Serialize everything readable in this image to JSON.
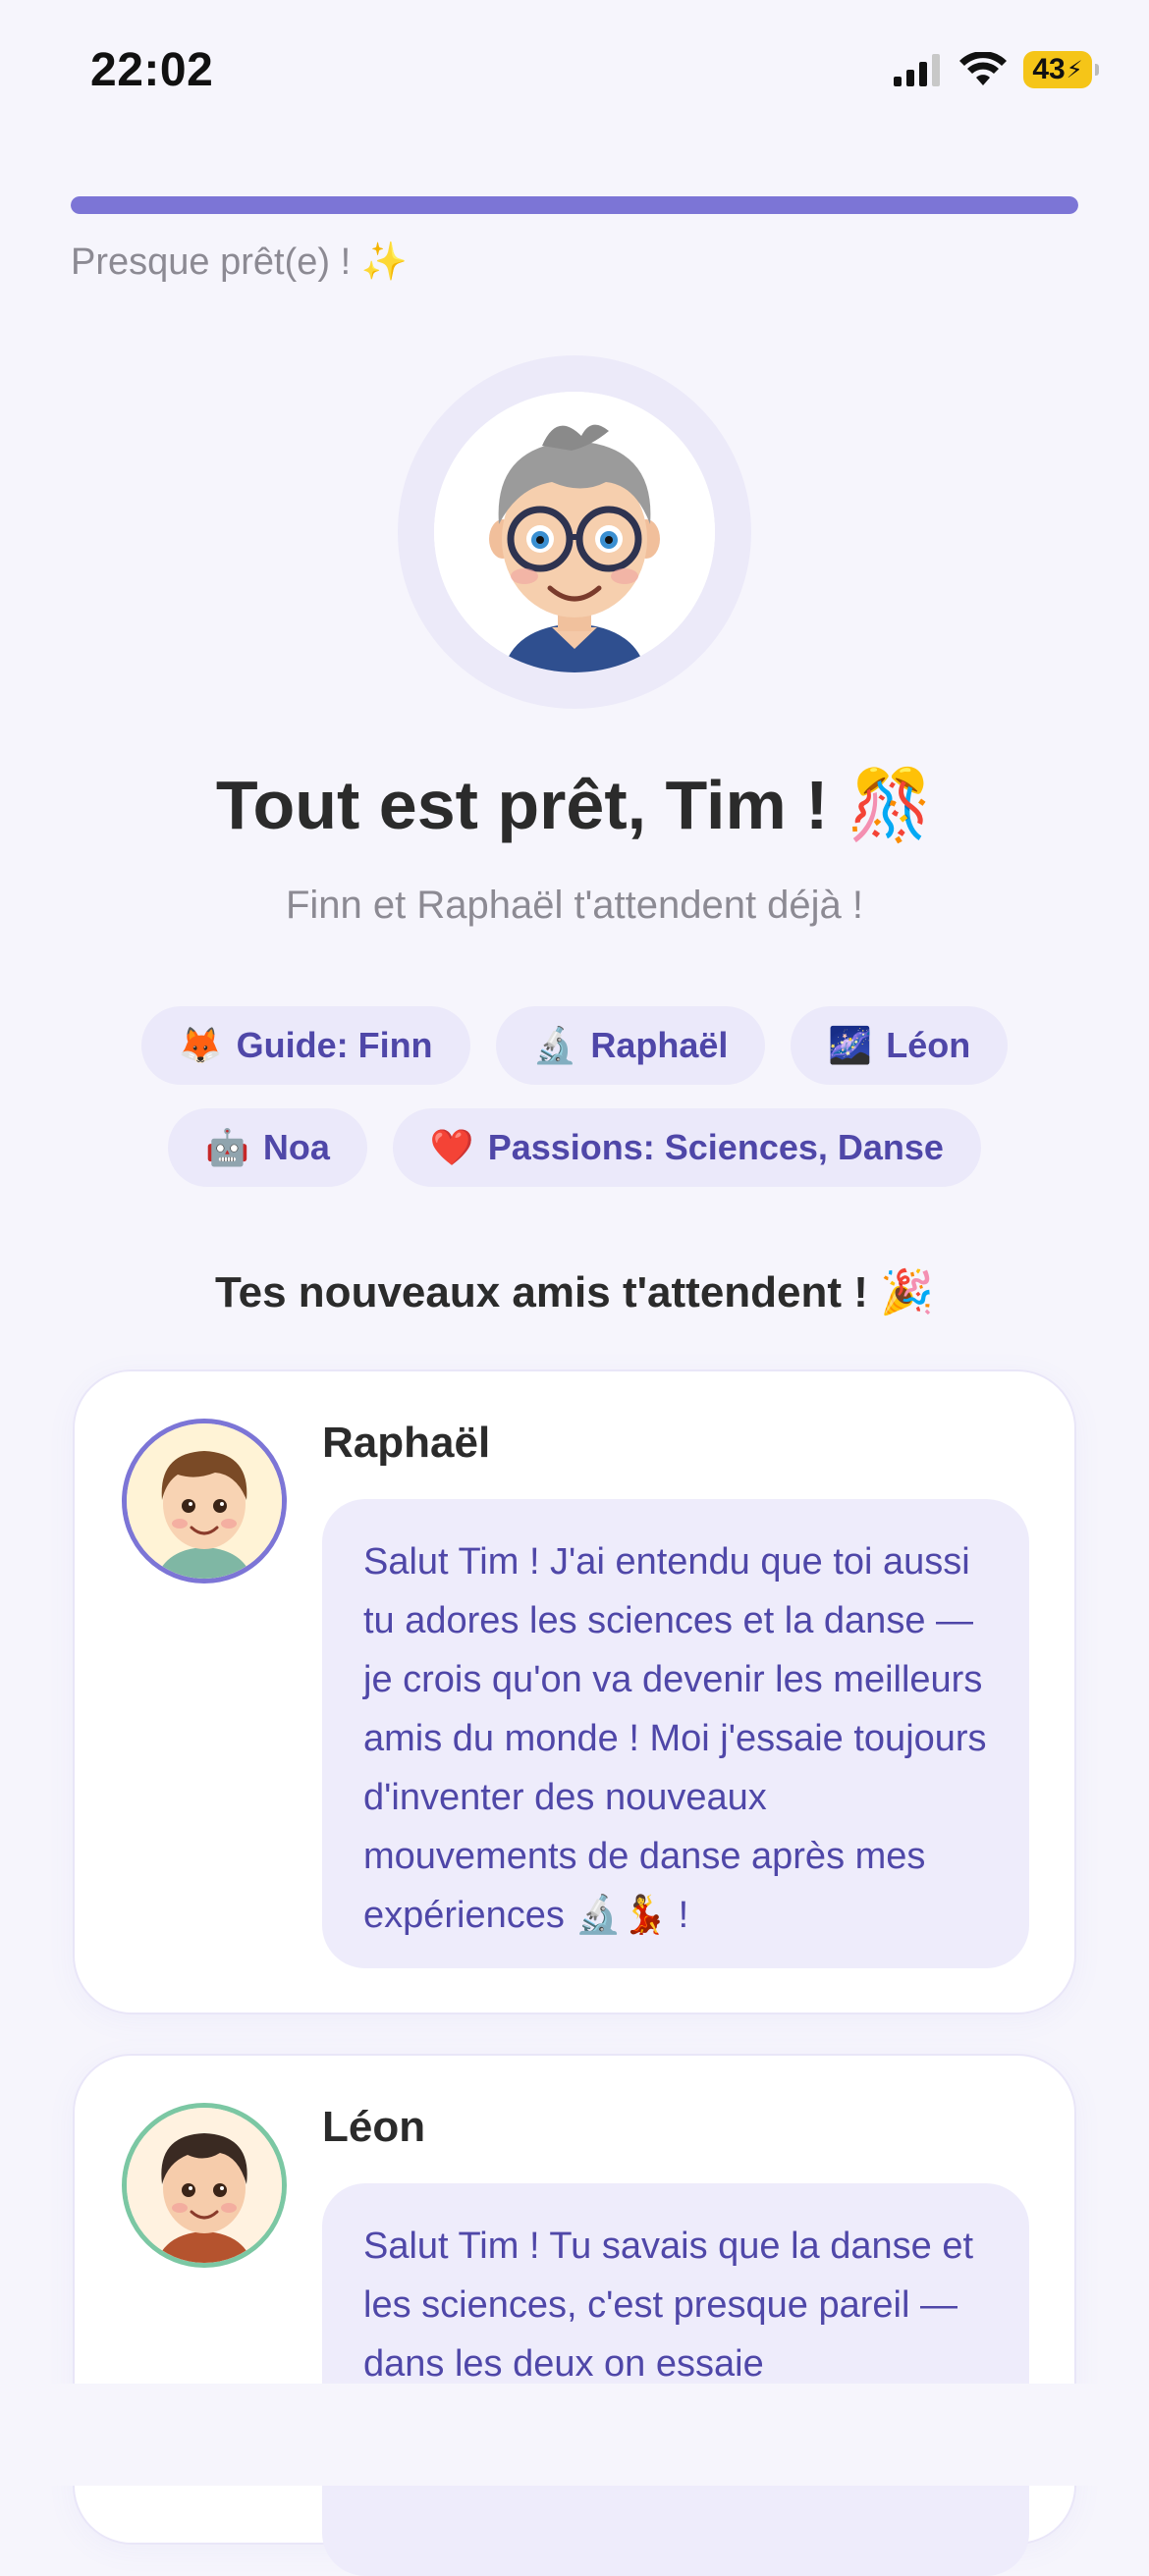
{
  "status_bar": {
    "time": "22:02",
    "battery": "43"
  },
  "progress": {
    "value_fraction": 1.0,
    "label": "Presque prêt(e) ! ✨"
  },
  "hero": {
    "title": "Tout est prêt, Tim ! 🎊",
    "subtitle": "Finn et Raphaël t'attendent déjà !"
  },
  "chips": [
    {
      "emoji": "🦊",
      "label": "Guide: Finn"
    },
    {
      "emoji": "🔬",
      "label": "Raphaël"
    },
    {
      "emoji": "🌌",
      "label": "Léon"
    },
    {
      "emoji": "🤖",
      "label": "Noa"
    },
    {
      "emoji": "❤️",
      "label": "Passions: Sciences, Danse"
    }
  ],
  "friends_section": {
    "title": "Tes nouveaux amis t'attendent ! 🎉",
    "cards": [
      {
        "name": "Raphaël",
        "message": "Salut Tim ! J'ai entendu que toi aussi tu adores les sciences et la danse — je crois qu'on va devenir les meilleurs amis du monde ! Moi j'essaie toujours d'inventer des nouveaux mouvements de danse après mes expériences 🔬💃 !"
      },
      {
        "name": "Léon",
        "message": "Salut Tim ! Tu savais que la danse et les sciences, c'est presque pareil — dans les deux on essaie"
      }
    ]
  },
  "colors": {
    "accent": "#7c75d6",
    "chip_bg": "#ebe9fa",
    "chip_text": "#4f47a8",
    "background": "#f6f5fc"
  }
}
